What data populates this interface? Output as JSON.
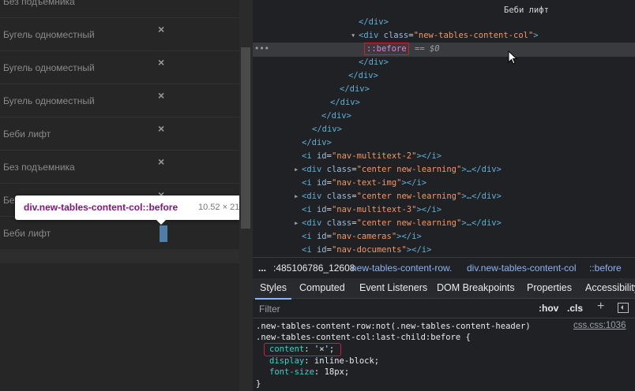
{
  "page": {
    "rows": [
      {
        "name": "Без подъемника",
        "close": "×"
      },
      {
        "name": "Бугель одноместный",
        "close": "×"
      },
      {
        "name": "Бугель одноместный",
        "close": "×"
      },
      {
        "name": "Бугель одноместный",
        "close": "×"
      },
      {
        "name": "Беби лифт",
        "close": "×"
      },
      {
        "name": "Без подъемника",
        "close": "×"
      },
      {
        "name": "Беби лифт",
        "close": "×"
      },
      {
        "name": "Беби лифт",
        "close": "×"
      }
    ]
  },
  "tooltip": {
    "name": "div.new-tables-content-col::before",
    "size": "10.52 × 21"
  },
  "elements": {
    "top_text": "Беби лифт",
    "lines": {
      "div_close": "</div>",
      "open_tag": "div",
      "open_attr": "class",
      "open_val": "\"new-tables-content-col\"",
      "pseudo": "::before",
      "eq": "== $0",
      "i_name": "i",
      "id_attr": "id",
      "i_close": "</i>",
      "center_val": "\"center new-learning\"",
      "ellipsis_close": "…</div>",
      "navm2": "\"nav-multitext-2\"",
      "navti": "\"nav-text-img\"",
      "navm3": "\"nav-multitext-3\"",
      "navcam": "\"nav-cameras\"",
      "navdoc": "\"nav-documents\""
    }
  },
  "breadcrumb": {
    "more": "...",
    "item1": ":485106786_12608",
    "item2": "new-tables-content-row.",
    "item3": "div.new-tables-content-col",
    "item4": "::before"
  },
  "tabs": [
    "Styles",
    "Computed",
    "Event Listeners",
    "DOM Breakpoints",
    "Properties",
    "Accessibility"
  ],
  "filter": {
    "placeholder": "Filter",
    "hov": ":hov",
    "cls": ".cls",
    "plus": "+"
  },
  "rules": {
    "selector1": ".new-tables-content-row:not(.new-tables-content-header)",
    "selector2": ".new-tables-content-col:last-child:before {",
    "source": "css.css:1036",
    "props": [
      {
        "name": "content",
        "value": "'×';"
      },
      {
        "name": "display",
        "value": "inline-block;"
      },
      {
        "name": "font-size",
        "value": "18px;"
      }
    ],
    "close": "}"
  },
  "colors": {
    "highlight": "#4f7fa8",
    "annotation": "#d0212a",
    "tag": "#5db0d7"
  }
}
